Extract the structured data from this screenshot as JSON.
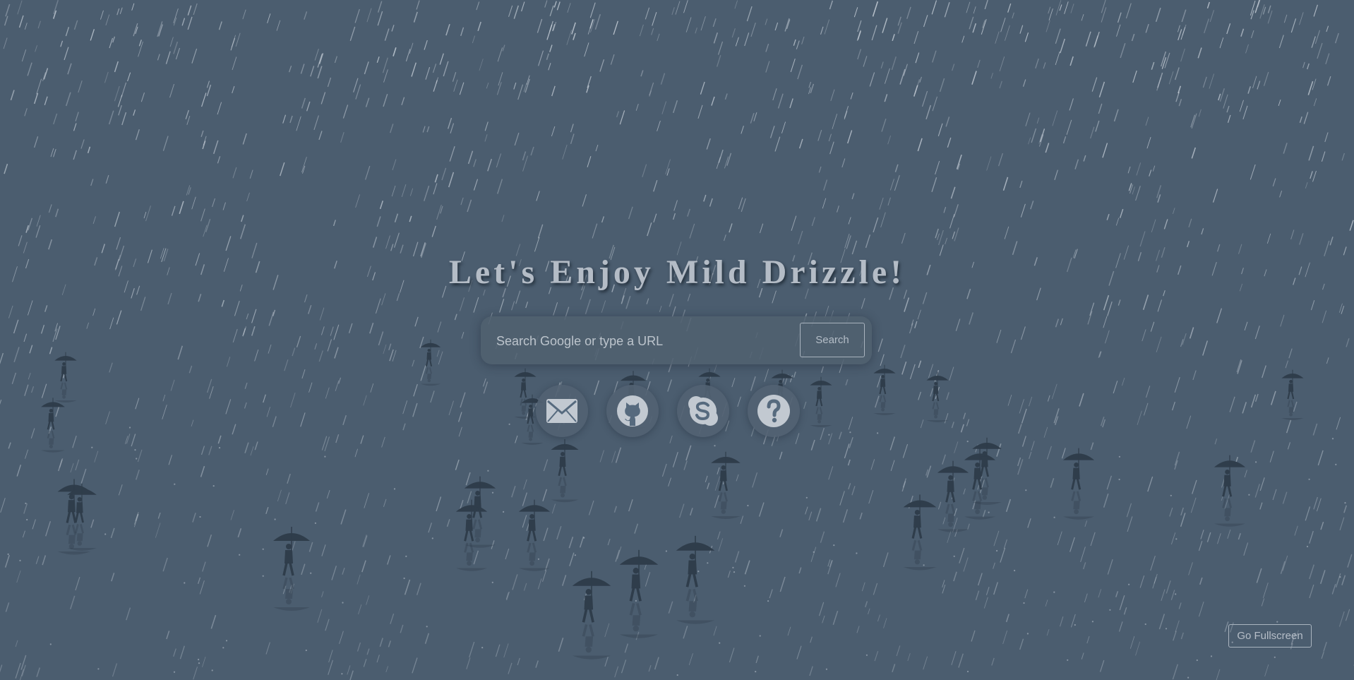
{
  "page": {
    "background": "#4b5d6f",
    "accent_text": "#b4bcc6"
  },
  "title": "Let's Enjoy Mild Drizzle!",
  "search": {
    "placeholder": "Search Google or type a URL",
    "value": "",
    "button_label": "Search"
  },
  "shortcuts": [
    {
      "name": "email",
      "icon": "envelope-icon"
    },
    {
      "name": "github",
      "icon": "github-icon"
    },
    {
      "name": "skype",
      "icon": "skype-icon"
    },
    {
      "name": "help",
      "icon": "question-icon"
    }
  ],
  "fullscreen_label": "Go Fullscreen"
}
